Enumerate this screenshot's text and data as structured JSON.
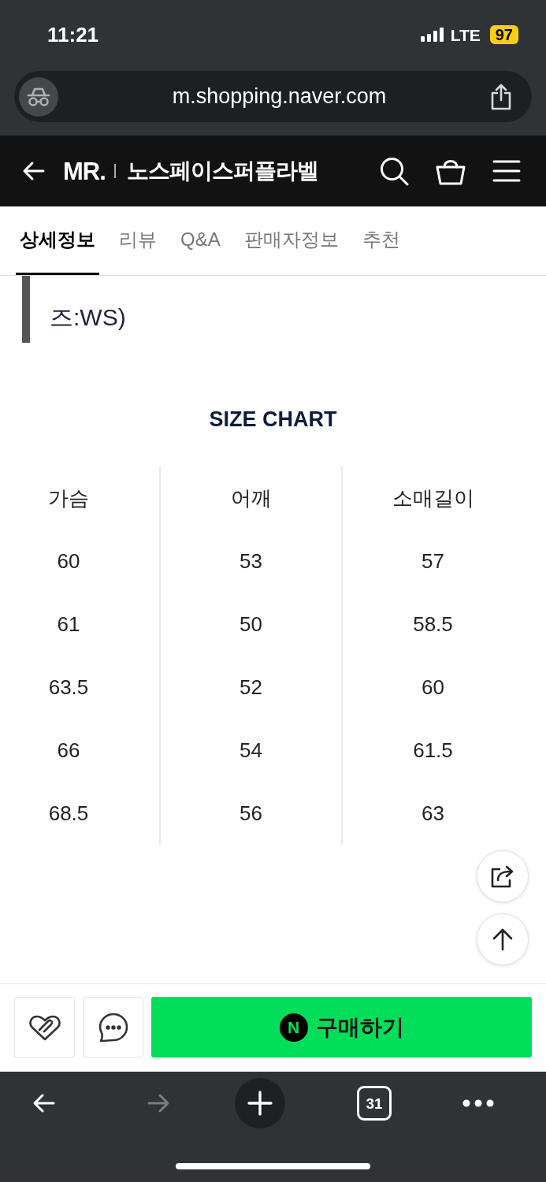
{
  "status_bar": {
    "time": "11:21",
    "network": "LTE",
    "battery": "97"
  },
  "address_bar": {
    "url": "m.shopping.naver.com"
  },
  "header": {
    "logo": "MR.",
    "store_name": "노스페이스퍼플라벨"
  },
  "tabs": [
    {
      "label": "상세정보",
      "selected": true
    },
    {
      "label": "리뷰",
      "selected": false
    },
    {
      "label": "Q&A",
      "selected": false
    },
    {
      "label": "판매자정보",
      "selected": false
    },
    {
      "label": "추천",
      "selected": false
    }
  ],
  "description": {
    "quote_text": "즈:WS)"
  },
  "size_chart": {
    "title": "SIZE CHART",
    "columns": [
      "가슴",
      "어깨",
      "소매길이"
    ],
    "rows": [
      [
        "60",
        "53",
        "57"
      ],
      [
        "61",
        "50",
        "58.5"
      ],
      [
        "63.5",
        "52",
        "60"
      ],
      [
        "66",
        "54",
        "61.5"
      ],
      [
        "68.5",
        "56",
        "63"
      ]
    ]
  },
  "purchase_bar": {
    "buy_button": {
      "badge": "N",
      "label": "구매하기"
    }
  },
  "browser_toolbar": {
    "back": {
      "disabled": false
    },
    "forward": {
      "disabled": true
    },
    "tab_count": "31"
  }
}
